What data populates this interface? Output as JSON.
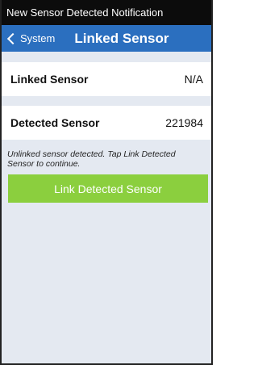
{
  "window": {
    "title": "New Sensor Detected Notification"
  },
  "nav": {
    "back_label": "System",
    "title": "Linked Sensor",
    "bar_color": "#2b6fbf"
  },
  "rows": [
    {
      "label": "Linked Sensor",
      "value": "N/A"
    },
    {
      "label": "Detected Sensor",
      "value": "221984"
    }
  ],
  "notice": "Unlinked sensor detected. Tap Link Detected Sensor to continue.",
  "button": {
    "label": "Link Detected Sensor",
    "color": "#8bcf3e"
  },
  "icons": {
    "back": "chevron-left-icon"
  }
}
